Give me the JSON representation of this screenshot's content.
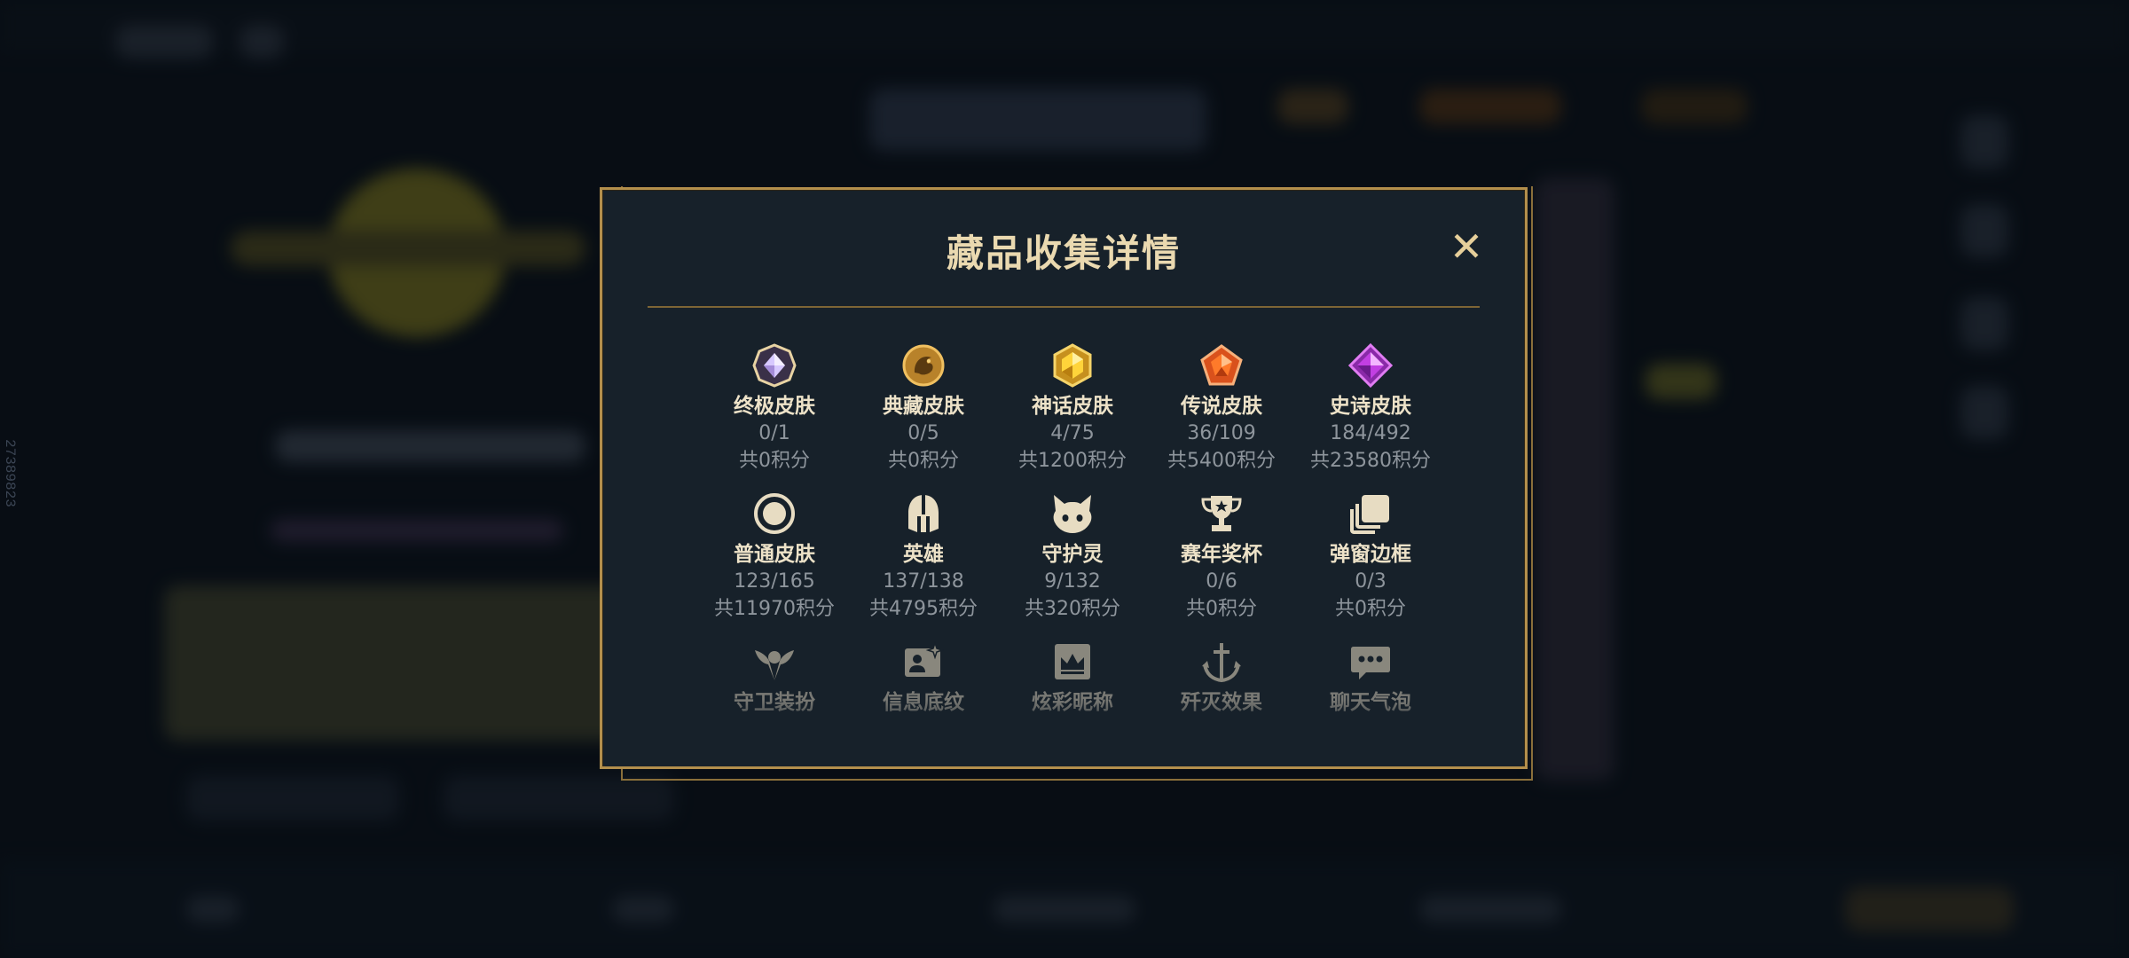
{
  "background": {
    "side_id": "27389823"
  },
  "modal": {
    "title": "藏品收集详情",
    "close_glyph": "✕",
    "items": [
      {
        "name": "终极皮肤",
        "count": "0/1",
        "points": "共0积分",
        "icon": "ultimate-gem-icon"
      },
      {
        "name": "典藏皮肤",
        "count": "0/5",
        "points": "共0积分",
        "icon": "dragon-medallion-icon"
      },
      {
        "name": "神话皮肤",
        "count": "4/75",
        "points": "共1200积分",
        "icon": "mythic-gem-icon"
      },
      {
        "name": "传说皮肤",
        "count": "36/109",
        "points": "共5400积分",
        "icon": "legendary-gem-icon"
      },
      {
        "name": "史诗皮肤",
        "count": "184/492",
        "points": "共23580积分",
        "icon": "epic-gem-icon"
      },
      {
        "name": "普通皮肤",
        "count": "123/165",
        "points": "共11970积分",
        "icon": "ring-icon"
      },
      {
        "name": "英雄",
        "count": "137/138",
        "points": "共4795积分",
        "icon": "helmet-icon"
      },
      {
        "name": "守护灵",
        "count": "9/132",
        "points": "共320积分",
        "icon": "guardian-spirit-icon"
      },
      {
        "name": "赛年奖杯",
        "count": "0/6",
        "points": "共0积分",
        "icon": "trophy-icon"
      },
      {
        "name": "弹窗边框",
        "count": "0/3",
        "points": "共0积分",
        "icon": "stacked-frames-icon"
      },
      {
        "name": "守卫装扮",
        "icon": "ward-icon"
      },
      {
        "name": "信息底纹",
        "icon": "profile-card-icon"
      },
      {
        "name": "炫彩昵称",
        "icon": "crown-frame-icon"
      },
      {
        "name": "歼灭效果",
        "icon": "anchor-sword-icon"
      },
      {
        "name": "聊天气泡",
        "icon": "chat-bubble-icon"
      }
    ]
  },
  "colors": {
    "gold_border": "#b38f4c",
    "panel_bg": "#17212a",
    "title_text": "#ead9b0",
    "muted_text": "#8e959c"
  }
}
